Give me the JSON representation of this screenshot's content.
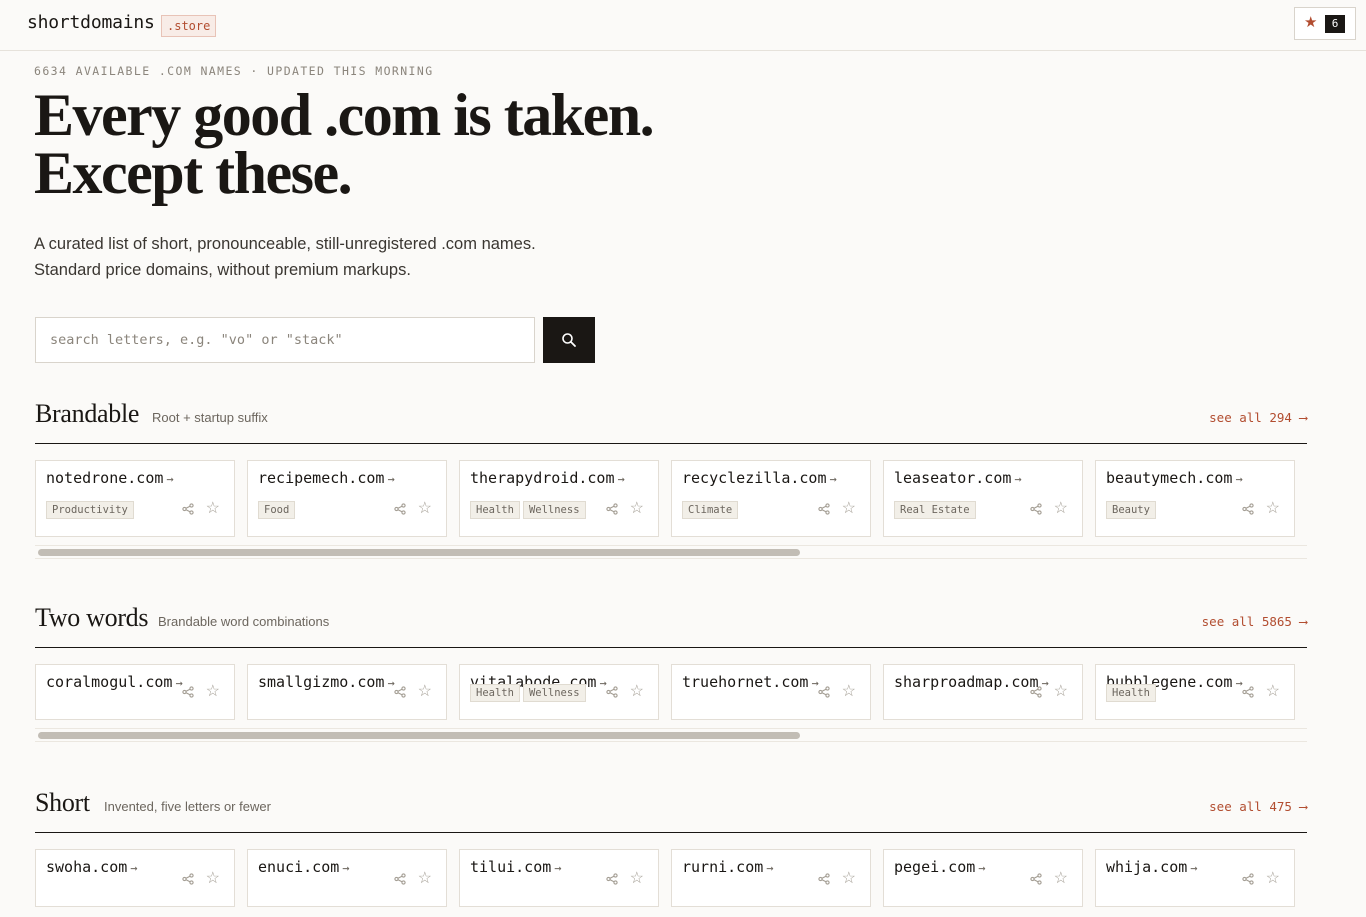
{
  "header": {
    "logo": "shortdomains",
    "logo_badge": ".store",
    "star_icon": "★",
    "star_count": "6"
  },
  "hero": {
    "kicker": "6634 AVAILABLE .COM NAMES · UPDATED THIS MORNING",
    "headline_line1": "Every good .com is taken.",
    "headline_line2": "Except these.",
    "sub_line1": "A curated list of short, pronounceable, still-unregistered .com names.",
    "sub_line2": "Standard price domains, without premium markups."
  },
  "search": {
    "placeholder": "search letters, e.g. \"vo\" or \"stack\"",
    "button_icon": "search-icon"
  },
  "sections": [
    {
      "title": "Brandable",
      "description": "Root + startup suffix",
      "see_all": "see all 294 ⟶",
      "cards": [
        {
          "domain": "notedrone.com",
          "tags": [
            "Productivity"
          ]
        },
        {
          "domain": "recipemech.com",
          "tags": [
            "Food"
          ]
        },
        {
          "domain": "therapydroid.com",
          "tags": [
            "Health",
            "Wellness"
          ]
        },
        {
          "domain": "recyclezilla.com",
          "tags": [
            "Climate"
          ]
        },
        {
          "domain": "leaseator.com",
          "tags": [
            "Real Estate"
          ]
        },
        {
          "domain": "beautymech.com",
          "tags": [
            "Beauty"
          ]
        }
      ]
    },
    {
      "title": "Two words",
      "description": "Brandable word combinations",
      "see_all": "see all 5865 ⟶",
      "cards": [
        {
          "domain": "coralmogul.com",
          "tags": []
        },
        {
          "domain": "smallgizmo.com",
          "tags": []
        },
        {
          "domain": "vitalabode.com",
          "tags": [
            "Health",
            "Wellness"
          ]
        },
        {
          "domain": "truehornet.com",
          "tags": []
        },
        {
          "domain": "sharproadmap.com",
          "tags": []
        },
        {
          "domain": "bubblegene.com",
          "tags": [
            "Health"
          ]
        }
      ]
    },
    {
      "title": "Short",
      "description": "Invented, five letters or fewer",
      "see_all": "see all 475 ⟶",
      "cards": [
        {
          "domain": "swoha.com",
          "tags": []
        },
        {
          "domain": "enuci.com",
          "tags": []
        },
        {
          "domain": "tilui.com",
          "tags": []
        },
        {
          "domain": "rurni.com",
          "tags": []
        },
        {
          "domain": "pegei.com",
          "tags": []
        },
        {
          "domain": "whija.com",
          "tags": []
        }
      ]
    }
  ],
  "card_icons": {
    "arrow": "→",
    "share": "share-icon",
    "favorite": "☆"
  },
  "colors": {
    "accent": "#b24d30",
    "ink": "#1a1714",
    "background": "#fbfaf8"
  }
}
